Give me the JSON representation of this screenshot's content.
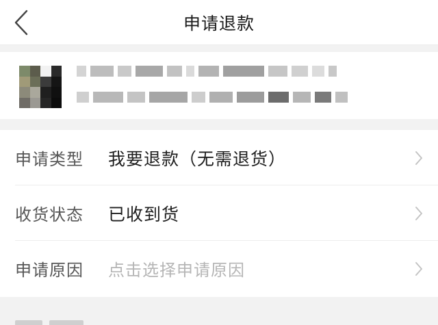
{
  "nav": {
    "title": "申请退款"
  },
  "product": {
    "thumbnail_icon": "product-thumbnail-icon"
  },
  "form": {
    "rows": [
      {
        "label": "申请类型",
        "value": "我要退款（无需退货）"
      },
      {
        "label": "收货状态",
        "value": "已收到货"
      },
      {
        "label": "申请原因",
        "placeholder": "点击选择申请原因"
      }
    ]
  },
  "colors": {
    "accent": "#1a1a1a",
    "placeholder": "#b5b5b5",
    "background": "#f2f2f2"
  }
}
